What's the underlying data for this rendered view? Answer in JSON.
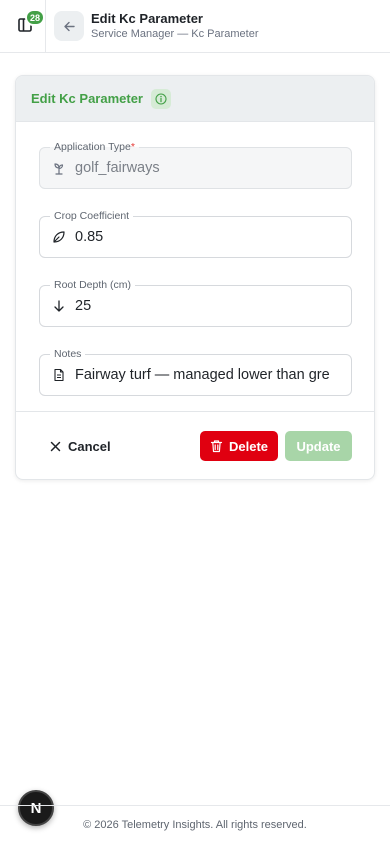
{
  "header": {
    "notification_count": "28",
    "title": "Edit Kc Parameter",
    "subtitle": "Service Manager — Kc Parameter"
  },
  "card": {
    "title": "Edit Kc Parameter",
    "fields": {
      "application_type": {
        "label": "Application Type",
        "required_mark": "*",
        "value": "golf_fairways",
        "icon": "sprout-icon"
      },
      "crop_coefficient": {
        "label": "Crop Coefficient",
        "value": "0.85",
        "icon": "leaf-icon"
      },
      "root_depth": {
        "label": "Root Depth (cm)",
        "value": "25",
        "icon": "arrow-down-icon"
      },
      "notes": {
        "label": "Notes",
        "value": "Fairway turf — managed lower than gre",
        "icon": "document-icon"
      }
    },
    "actions": {
      "cancel": "Cancel",
      "delete": "Delete",
      "update": "Update"
    }
  },
  "footer": {
    "copyright": "© 2026 Telemetry Insights. All rights reserved.",
    "next_badge": "N"
  },
  "colors": {
    "accent_green": "#43a047",
    "danger_red": "#e00010",
    "disabled_green": "#a8d5a8"
  }
}
